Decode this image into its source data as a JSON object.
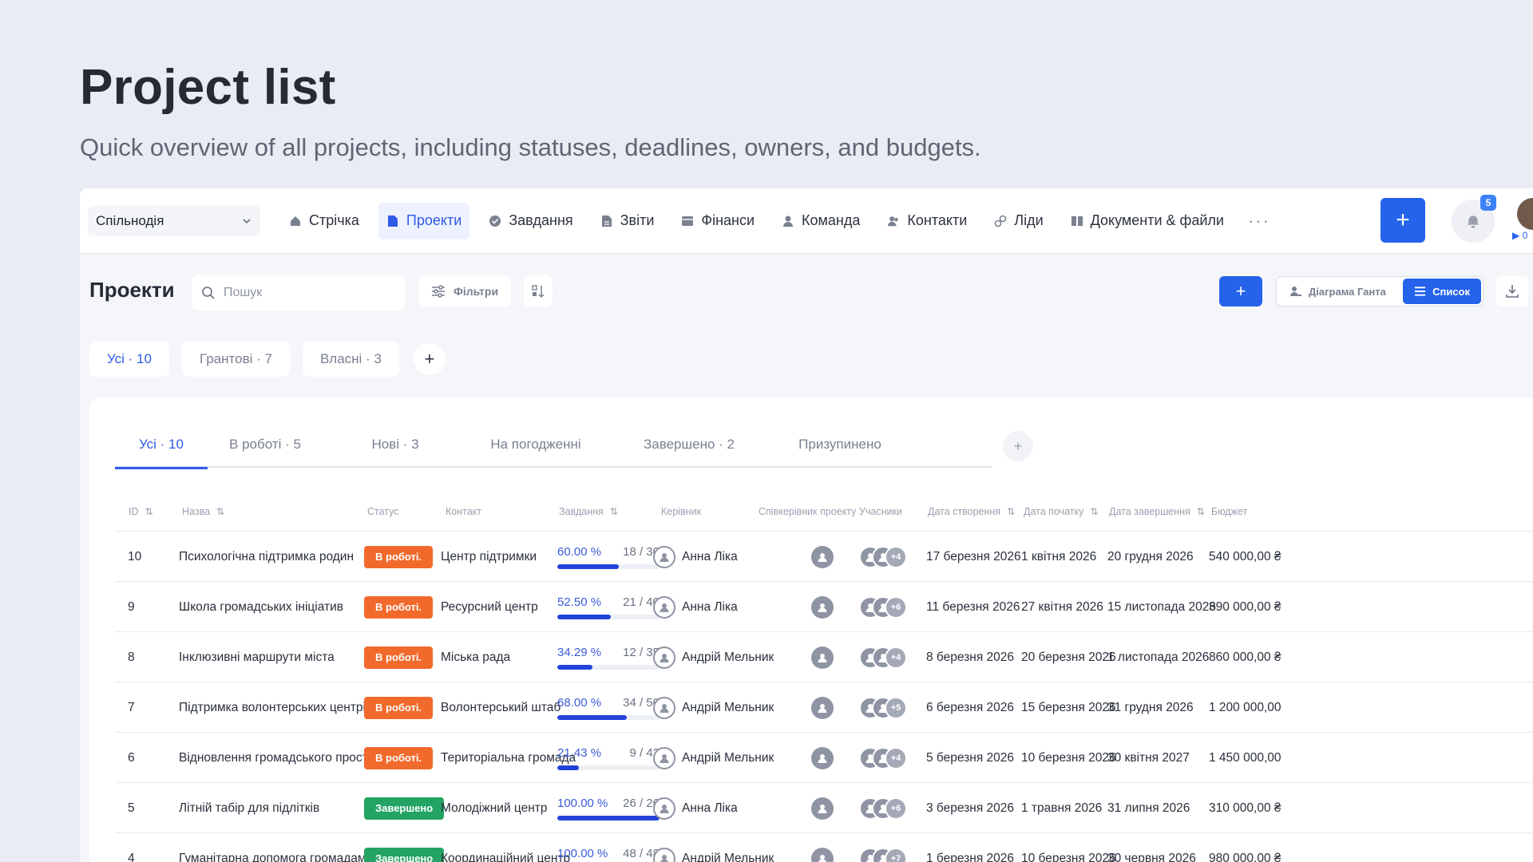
{
  "hero": {
    "title": "Project list",
    "subtitle": "Quick overview of all projects, including statuses, deadlines, owners, and budgets."
  },
  "topbar": {
    "workspace": "Спільнодія",
    "nav": [
      {
        "label": "Стрічка",
        "icon": "home-icon",
        "active": false
      },
      {
        "label": "Проекти",
        "icon": "document-icon",
        "active": true
      },
      {
        "label": "Завдання",
        "icon": "check-circle-icon",
        "active": false
      },
      {
        "label": "Звіти",
        "icon": "report-icon",
        "active": false
      },
      {
        "label": "Фінанси",
        "icon": "wallet-icon",
        "active": false
      },
      {
        "label": "Команда",
        "icon": "user-icon",
        "active": false
      },
      {
        "label": "Контакти",
        "icon": "contacts-icon",
        "active": false
      },
      {
        "label": "Ліди",
        "icon": "link-icon",
        "active": false
      },
      {
        "label": "Документи & файли",
        "icon": "book-icon",
        "active": false
      }
    ],
    "more": "···",
    "notifications": "5",
    "user_tag": "▶ 0"
  },
  "toolbar": {
    "title": "Проекти",
    "search_placeholder": "Пошук",
    "filters_label": "Фільтри",
    "add_label": "+",
    "gantt_label": "Діаграма Ганта",
    "list_label": "Список"
  },
  "groups": [
    {
      "label": "Усі · 10",
      "active": true
    },
    {
      "label": "Грантові · 7",
      "active": false
    },
    {
      "label": "Власні · 3",
      "active": false
    }
  ],
  "status_tabs": [
    {
      "label": "Усі · 10",
      "active": true
    },
    {
      "label": "В роботі · 5",
      "active": false
    },
    {
      "label": "Нові · 3",
      "active": false
    },
    {
      "label": "На погодженні",
      "active": false
    },
    {
      "label": "Завершено · 2",
      "active": false
    },
    {
      "label": "Призупинено",
      "active": false
    }
  ],
  "columns": {
    "id": "ID",
    "name": "Назва",
    "status": "Статус",
    "contact": "Контакт",
    "tasks": "Завдання",
    "manager": "Керівник",
    "co_manager": "Співкерівник проекту",
    "members": "Учасники",
    "created": "Дата створення",
    "start": "Дата початку",
    "end": "Дата завершення",
    "budget": "Бюджет"
  },
  "colors": {
    "accent": "#2563eb",
    "in_progress": "#f26a2b",
    "done": "#23a464"
  },
  "rows": [
    {
      "id": "10",
      "name": "Психологічна підтримка родин",
      "status": "В роботі.",
      "status_type": "work",
      "contact": "Центр підтримки",
      "pct": "60.00 %",
      "count": "18 / 30",
      "fraction": 0.6,
      "manager": "Анна Ліка",
      "extra": "+4",
      "created": "17 березня 2026",
      "start": "1 квітня 2026",
      "end": "20 грудня 2026",
      "budget": "540 000,00 ₴"
    },
    {
      "id": "9",
      "name": "Школа громадських ініціатив",
      "status": "В роботі.",
      "status_type": "work",
      "contact": "Ресурсний центр",
      "pct": "52.50 %",
      "count": "21 / 40",
      "fraction": 0.525,
      "manager": "Анна Ліка",
      "extra": "+6",
      "created": "11 березня 2026",
      "start": "27 квітня 2026",
      "end": "15 листопада 2026",
      "budget": "390 000,00 ₴"
    },
    {
      "id": "8",
      "name": "Інклюзивні маршрути міста",
      "status": "В роботі.",
      "status_type": "work",
      "contact": "Міська рада",
      "pct": "34.29 %",
      "count": "12 / 35",
      "fraction": 0.3429,
      "manager": "Андрій Мельник",
      "extra": "+4",
      "created": "8 березня 2026",
      "start": "20 березня 2026",
      "end": "1 листопада 2026",
      "budget": "860 000,00 ₴"
    },
    {
      "id": "7",
      "name": "Підтримка волонтерських центрів",
      "status": "В роботі.",
      "status_type": "work",
      "contact": "Волонтерський штаб",
      "pct": "68.00 %",
      "count": "34 / 50",
      "fraction": 0.68,
      "manager": "Андрій Мельник",
      "extra": "+5",
      "created": "6 березня 2026",
      "start": "15 березня 2026",
      "end": "31 грудня 2026",
      "budget": "1 200 000,00"
    },
    {
      "id": "6",
      "name": "Відновлення громадського простору",
      "status": "В роботі.",
      "status_type": "work",
      "contact": "Територіальна громада",
      "pct": "21.43 %",
      "count": "9 / 42",
      "fraction": 0.2143,
      "manager": "Андрій Мельник",
      "extra": "+4",
      "created": "5 березня 2026",
      "start": "10 березня 2026",
      "end": "30 квітня 2027",
      "budget": "1 450 000,00"
    },
    {
      "id": "5",
      "name": "Літній табір для підлітків",
      "status": "Завершено",
      "status_type": "done",
      "contact": "Молодіжний центр",
      "pct": "100.00 %",
      "count": "26 / 26",
      "fraction": 1.0,
      "manager": "Анна Ліка",
      "extra": "+6",
      "created": "3 березня 2026",
      "start": "1 травня 2026",
      "end": "31 липня 2026",
      "budget": "310 000,00 ₴"
    },
    {
      "id": "4",
      "name": "Гуманітарна допомога громадам",
      "status": "Завершено",
      "status_type": "done",
      "contact": "Координаційний центр",
      "pct": "100.00 %",
      "count": "48 / 48",
      "fraction": 1.0,
      "manager": "Андрій Мельник",
      "extra": "+7",
      "created": "1 березня 2026",
      "start": "10 березня 2026",
      "end": "30 червня 2026",
      "budget": "980 000,00 ₴"
    }
  ]
}
